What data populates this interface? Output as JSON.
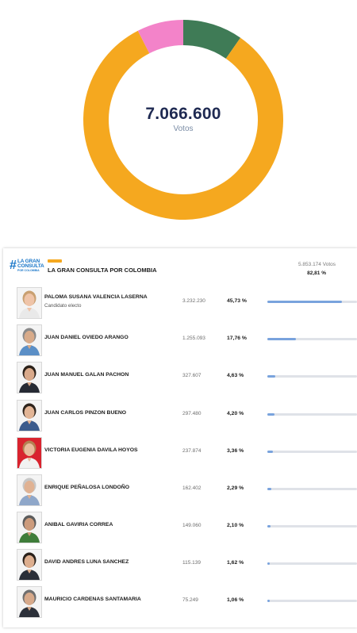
{
  "summary": {
    "total_votes": "7.066.600",
    "total_label": "Votos"
  },
  "chart_data": {
    "type": "pie",
    "categories": [
      "LA GRAN CONSULTA POR COLOMBIA",
      "Pink segment",
      "Green segment"
    ],
    "values": [
      82.81,
      7.5,
      9.69
    ],
    "colors": [
      "#f5a81f",
      "#f383c9",
      "#3f7b56"
    ],
    "hole": true
  },
  "party": {
    "logo_hash": "#",
    "logo_line1": "LA GRAN",
    "logo_line2": "CONSULTA",
    "logo_line3": "POR COLOMBIA",
    "name": "LA GRAN CONSULTA POR COLOMBIA",
    "color": "#f5a81f",
    "votes": "5.853.174 Votos",
    "percent": "82,81 %"
  },
  "candidates": [
    {
      "name": "PALOMA SUSANA VALENCIA LASERNA",
      "note": "Candidato electo",
      "votes": "3.232.230",
      "percent": "45,73 %",
      "share": 45.73,
      "photo": {
        "bg": "#f4f4f4",
        "skin": "#efc4a8",
        "hair": "#c9a071",
        "shirt": "#e9e9e9"
      }
    },
    {
      "name": "JUAN DANIEL OVIEDO ARANGO",
      "note": "",
      "votes": "1.255.093",
      "percent": "17,76 %",
      "share": 17.76,
      "photo": {
        "bg": "#f4f4f4",
        "skin": "#d8ab8a",
        "hair": "#8a8a8a",
        "shirt": "#5b8fc6"
      }
    },
    {
      "name": "JUAN MANUEL GALAN PACHON",
      "note": "",
      "votes": "327.607",
      "percent": "4,63 %",
      "share": 4.63,
      "photo": {
        "bg": "#f4f4f4",
        "skin": "#d9a98a",
        "hair": "#2b2119",
        "shirt": "#262a33"
      }
    },
    {
      "name": "JUAN CARLOS PINZON BUENO",
      "note": "",
      "votes": "297.480",
      "percent": "4,20 %",
      "share": 4.2,
      "photo": {
        "bg": "#f4f4f4",
        "skin": "#e2b596",
        "hair": "#2e241c",
        "shirt": "#3c5b8c"
      }
    },
    {
      "name": "VICTORIA EUGENIA DAVILA HOYOS",
      "note": "",
      "votes": "237.874",
      "percent": "3,36 %",
      "share": 3.36,
      "photo": {
        "bg": "#d9232e",
        "skin": "#e9bb9d",
        "hair": "#b38152",
        "shirt": "#f2f2f2"
      }
    },
    {
      "name": "ENRIQUE PEÑALOSA LONDOÑO",
      "note": "",
      "votes": "162.402",
      "percent": "2,29 %",
      "share": 2.29,
      "photo": {
        "bg": "#f4f4f4",
        "skin": "#e0b293",
        "hair": "#c7c7c7",
        "shirt": "#8fa7c9"
      }
    },
    {
      "name": "ANIBAL GAVIRIA CORREA",
      "note": "",
      "votes": "149.060",
      "percent": "2,10 %",
      "share": 2.1,
      "photo": {
        "bg": "#f4f4f4",
        "skin": "#cc9b7c",
        "hair": "#5c5c5c",
        "shirt": "#3f7d3a"
      }
    },
    {
      "name": "DAVID ANDRES LUNA SANCHEZ",
      "note": "",
      "votes": "115.139",
      "percent": "1,62 %",
      "share": 1.62,
      "photo": {
        "bg": "#f4f4f4",
        "skin": "#ddae8e",
        "hair": "#2a211a",
        "shirt": "#2b2f38"
      }
    },
    {
      "name": "MAURICIO CARDENAS SANTAMARIA",
      "note": "",
      "votes": "75.249",
      "percent": "1,06 %",
      "share": 1.06,
      "photo": {
        "bg": "#f4f4f4",
        "skin": "#d7a98a",
        "hair": "#6f6f6f",
        "shirt": "#2c313a"
      }
    }
  ]
}
